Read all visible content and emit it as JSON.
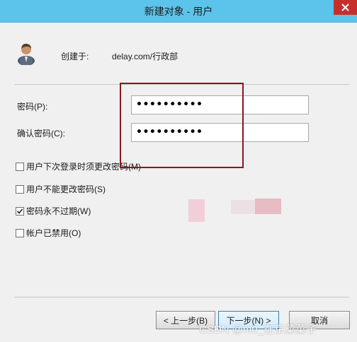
{
  "window": {
    "title": "新建对象 - 用户"
  },
  "header": {
    "created_in_label": "创建于:",
    "created_in_value": "delay.com/行政部"
  },
  "fields": {
    "password_label": "密码(P):",
    "password_value": "••••••••••",
    "confirm_label": "确认密码(C):",
    "confirm_value": "••••••••••"
  },
  "options": [
    {
      "label": "用户下次登录时须更改密码(M)",
      "checked": false
    },
    {
      "label": "用户不能更改密码(S)",
      "checked": false
    },
    {
      "label": "密码永不过期(W)",
      "checked": true
    },
    {
      "label": "帐户已禁用(O)",
      "checked": false
    }
  ],
  "buttons": {
    "back": "< 上一步(B)",
    "next": "下一步(N) >",
    "cancel": "取消"
  },
  "watermark": "CSDN @m0_在京菜菜子",
  "colors": {
    "titlebar": "#5cc3ea",
    "close": "#c7302a",
    "highlight": "#8a1620"
  }
}
